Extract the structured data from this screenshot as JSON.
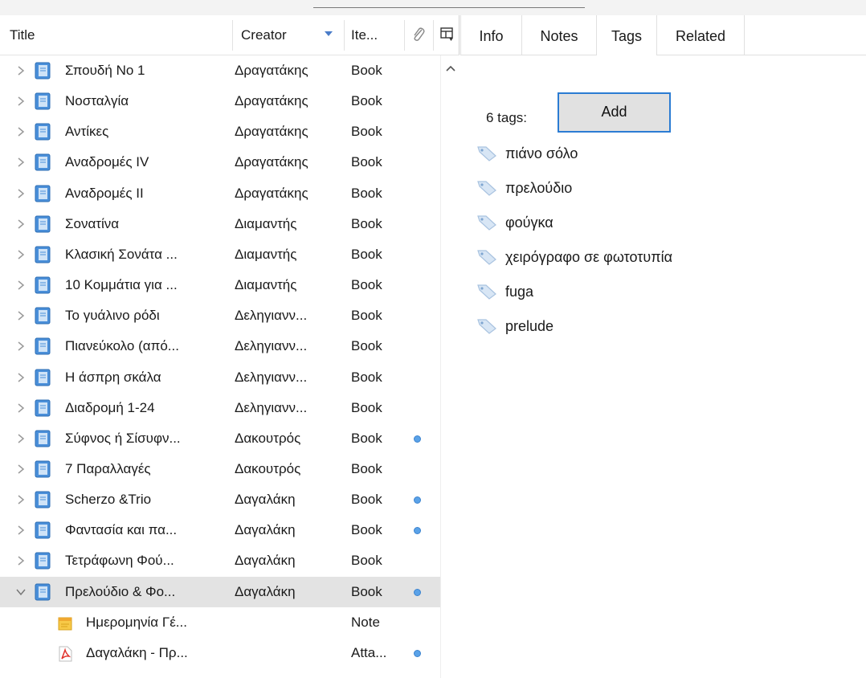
{
  "columns": {
    "title": "Title",
    "creator": "Creator",
    "item_type": "Ite..."
  },
  "items": [
    {
      "title": "Σπουδή Νο 1",
      "creator": "Δραγατάκης",
      "type": "Book",
      "expanded": false,
      "has_dot": false
    },
    {
      "title": "Νοσταλγία",
      "creator": "Δραγατάκης",
      "type": "Book",
      "expanded": false,
      "has_dot": false
    },
    {
      "title": "Αντίκες",
      "creator": "Δραγατάκης",
      "type": "Book",
      "expanded": false,
      "has_dot": false
    },
    {
      "title": "Αναδρομές IV",
      "creator": "Δραγατάκης",
      "type": "Book",
      "expanded": false,
      "has_dot": false
    },
    {
      "title": "Αναδρομές II",
      "creator": "Δραγατάκης",
      "type": "Book",
      "expanded": false,
      "has_dot": false
    },
    {
      "title": "Σονατίνα",
      "creator": "Διαμαντής",
      "type": "Book",
      "expanded": false,
      "has_dot": false
    },
    {
      "title": "Κλασική Σονάτα ...",
      "creator": "Διαμαντής",
      "type": "Book",
      "expanded": false,
      "has_dot": false
    },
    {
      "title": "10 Κομμάτια για ...",
      "creator": "Διαμαντής",
      "type": "Book",
      "expanded": false,
      "has_dot": false
    },
    {
      "title": "Το γυάλινο ρόδι",
      "creator": "Δεληγιανν...",
      "type": "Book",
      "expanded": false,
      "has_dot": false
    },
    {
      "title": "Πιανεύκολο (από...",
      "creator": "Δεληγιανν...",
      "type": "Book",
      "expanded": false,
      "has_dot": false
    },
    {
      "title": "Η άσπρη σκάλα",
      "creator": "Δεληγιανν...",
      "type": "Book",
      "expanded": false,
      "has_dot": false
    },
    {
      "title": "Διαδρομή 1-24",
      "creator": "Δεληγιανν...",
      "type": "Book",
      "expanded": false,
      "has_dot": false
    },
    {
      "title": "Σύφνος ή Σίσυφν...",
      "creator": "Δακουτρός",
      "type": "Book",
      "expanded": false,
      "has_dot": true
    },
    {
      "title": "7 Παραλλαγές",
      "creator": "Δακουτρός",
      "type": "Book",
      "expanded": false,
      "has_dot": false
    },
    {
      "title": "Scherzo &Trio",
      "creator": "Δαγαλάκη",
      "type": "Book",
      "expanded": false,
      "has_dot": true
    },
    {
      "title": "Φαντασία και πα...",
      "creator": "Δαγαλάκη",
      "type": "Book",
      "expanded": false,
      "has_dot": true
    },
    {
      "title": "Τετράφωνη Φού...",
      "creator": "Δαγαλάκη",
      "type": "Book",
      "expanded": false,
      "has_dot": false
    },
    {
      "title": "Πρελούδιο & Φο...",
      "creator": "Δαγαλάκη",
      "type": "Book",
      "expanded": true,
      "has_dot": true,
      "selected": true
    }
  ],
  "children": [
    {
      "title": "Ημερομηνία Γέ...",
      "type": "Note",
      "icon": "note-icon",
      "has_dot": false
    },
    {
      "title": "Δαγαλάκη - Πρ...",
      "type": "Atta...",
      "icon": "pdf-icon",
      "has_dot": true
    }
  ],
  "tabs": [
    {
      "label": "Info",
      "active": false
    },
    {
      "label": "Notes",
      "active": false
    },
    {
      "label": "Tags",
      "active": true
    },
    {
      "label": "Related",
      "active": false
    }
  ],
  "tags_panel": {
    "count_label": "6 tags:",
    "add_label": "Add",
    "tags": [
      "πιάνο σόλο",
      "πρελούδιο",
      "φούγκα",
      "χειρόγραφο σε φωτοτυπία",
      "fuga",
      "prelude"
    ]
  },
  "colors": {
    "book_icon": "#4a8fd9",
    "selection": "#e3e3e3",
    "dot": "#5aa2e8",
    "focus_border": "#2b7cd3"
  }
}
